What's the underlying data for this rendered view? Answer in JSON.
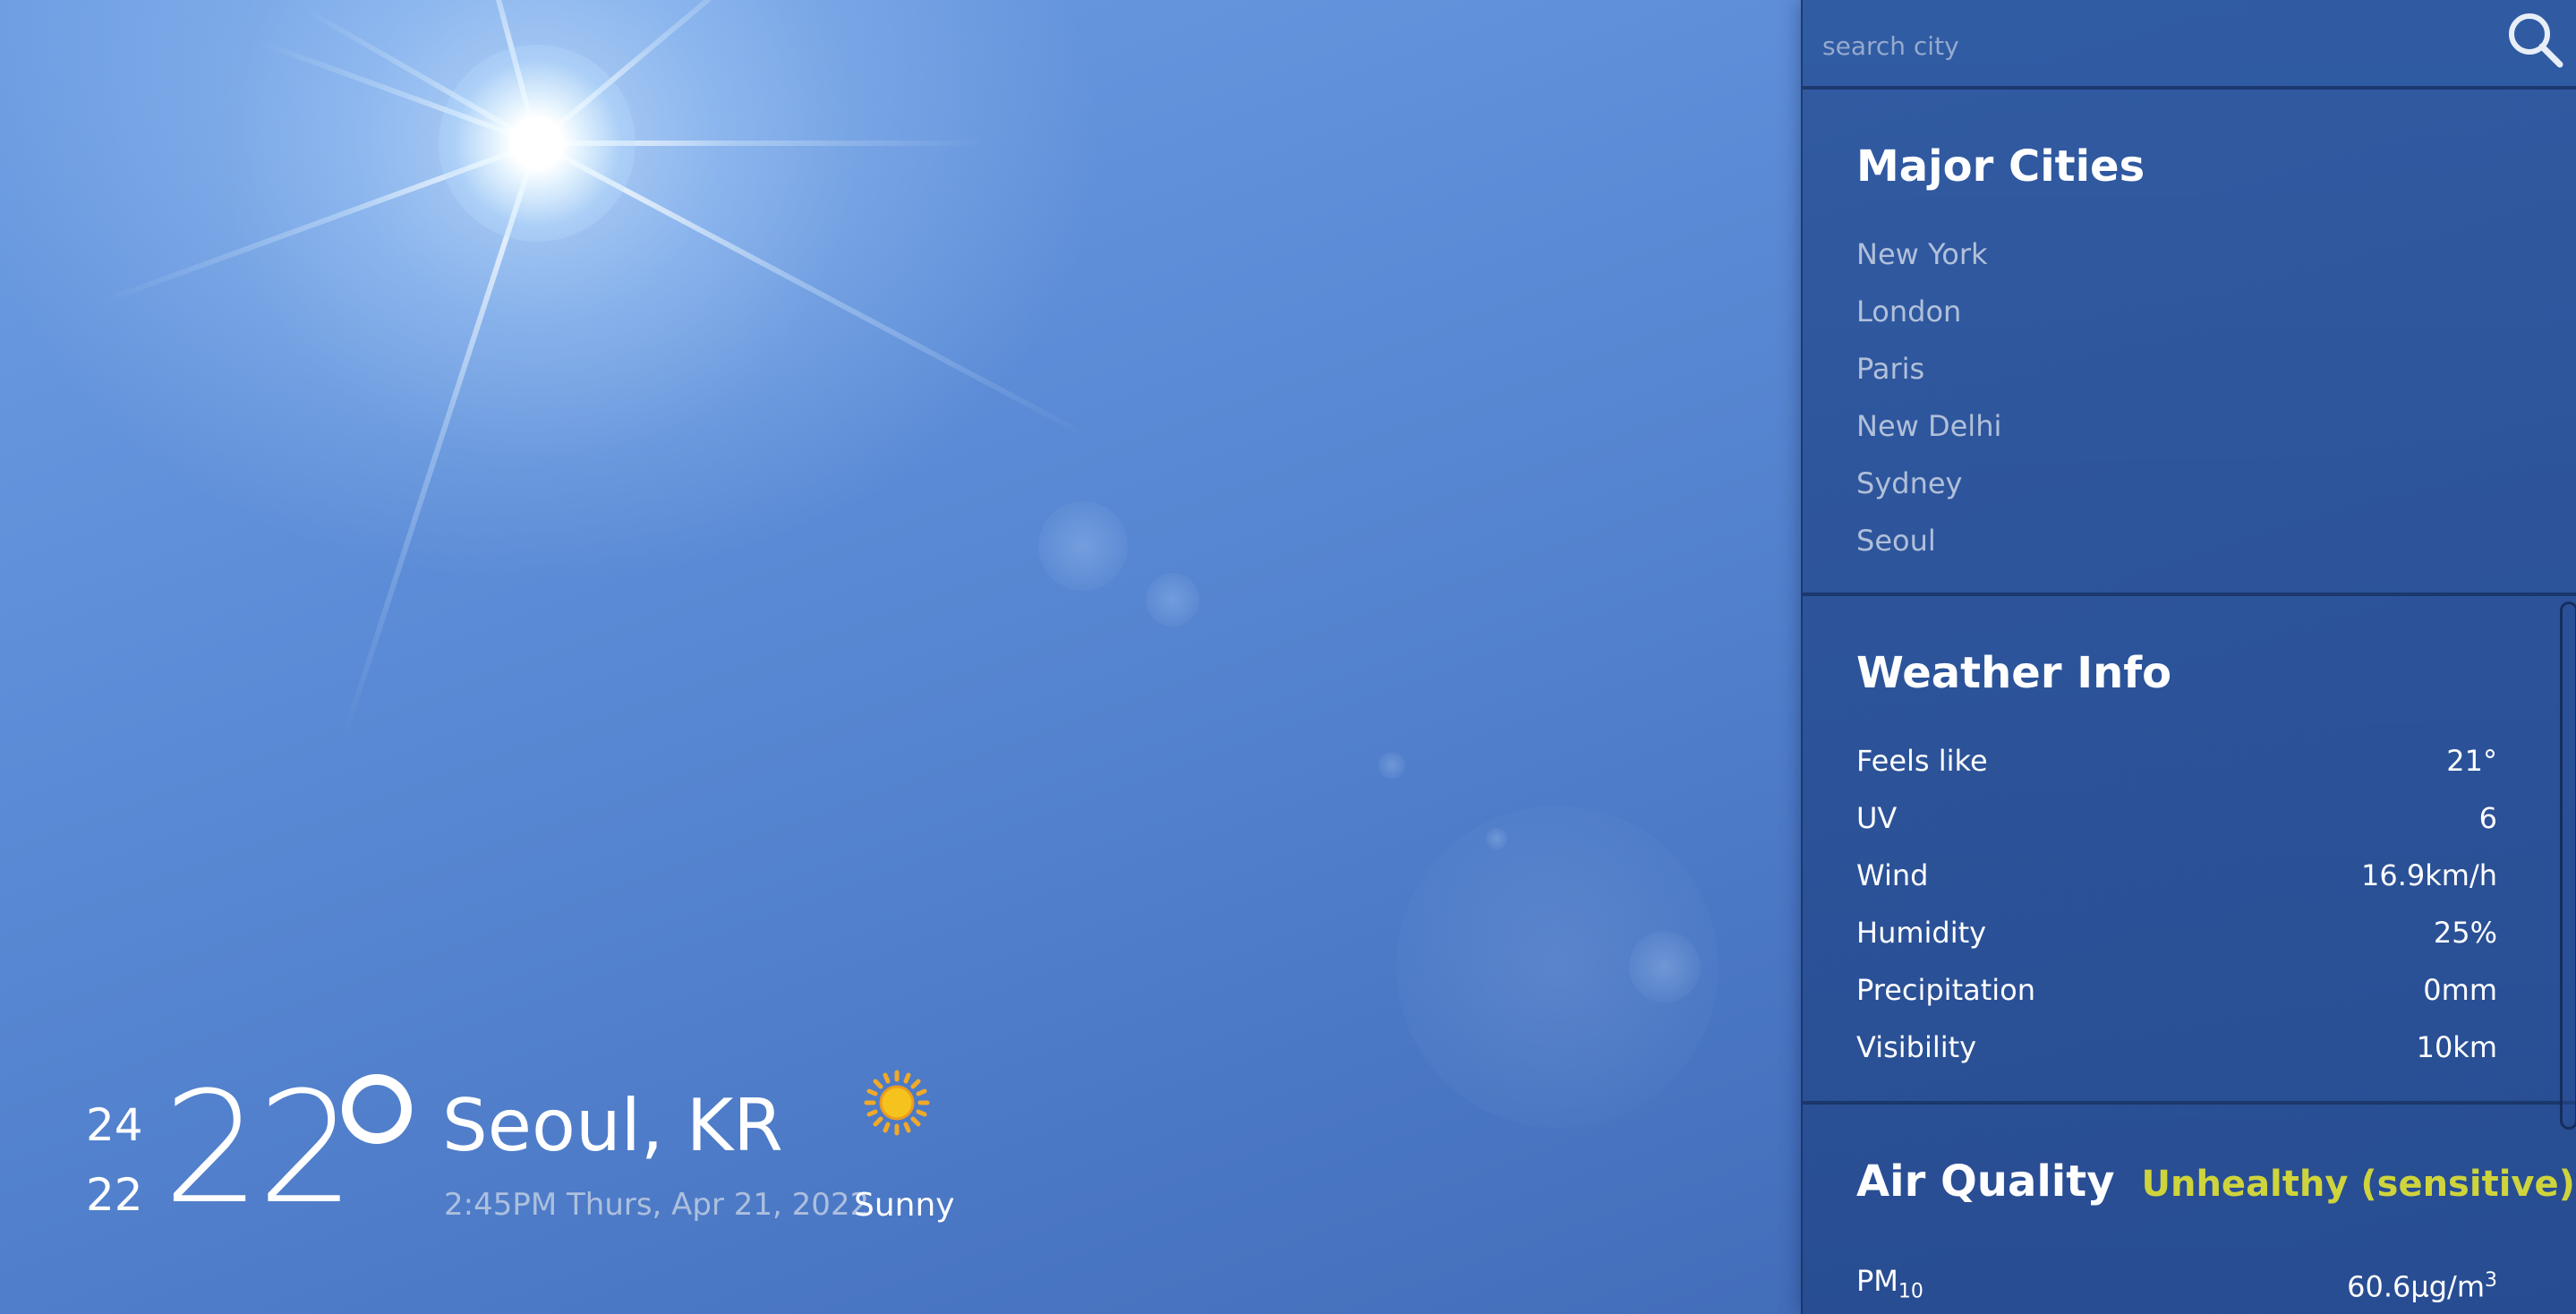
{
  "current": {
    "high": "24",
    "low": "22",
    "temperature": "22",
    "city": "Seoul, KR",
    "datetime": "2:45PM Thurs, Apr 21, 2022",
    "condition": "Sunny",
    "condition_icon": "sun-icon"
  },
  "search": {
    "placeholder": "search city",
    "value": "",
    "icon": "search-icon"
  },
  "major_cities": {
    "title": "Major Cities",
    "items": [
      "New York",
      "London",
      "Paris",
      "New Delhi",
      "Sydney",
      "Seoul"
    ]
  },
  "weather_info": {
    "title": "Weather Info",
    "rows": [
      {
        "label": "Feels like",
        "value": "21°"
      },
      {
        "label": "UV",
        "value": "6"
      },
      {
        "label": "Wind",
        "value": "16.9km/h"
      },
      {
        "label": "Humidity",
        "value": "25%"
      },
      {
        "label": "Precipitation",
        "value": "0mm"
      },
      {
        "label": "Visibility",
        "value": "10km"
      }
    ]
  },
  "air_quality": {
    "title": "Air Quality",
    "status": "Unhealthy (sensitive)",
    "status_color": "#cfd43c",
    "pm10_label_main": "PM",
    "pm10_label_sub": "10",
    "pm10_value": "60.6μg/m",
    "pm10_value_sup": "3"
  }
}
